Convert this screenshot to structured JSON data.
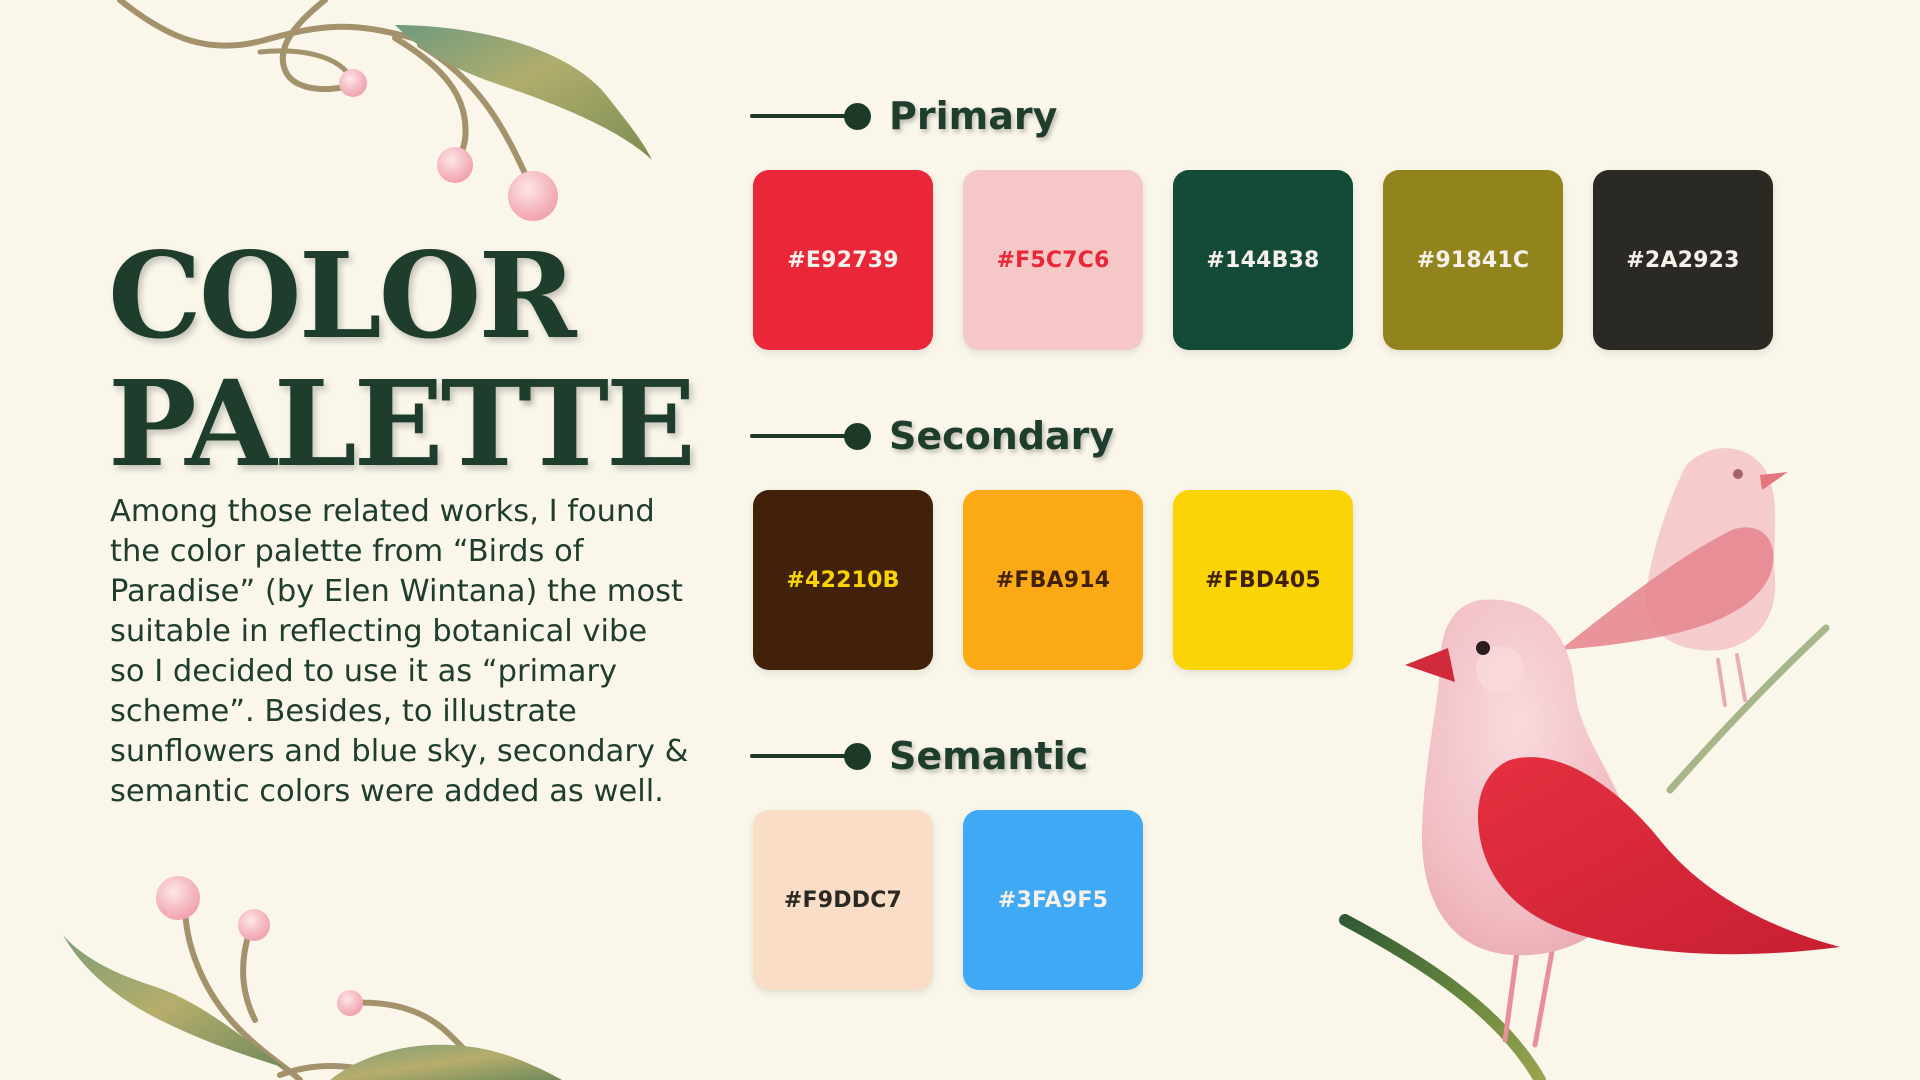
{
  "title": {
    "line1": "COLOR",
    "line2": "PALETTE"
  },
  "description": "Among those related works, I found the color palette from “Birds of Paradise” (by Elen Wintana) the most suitable in reflecting botanical vibe so I decided to use it as “primary scheme”. Besides, to illustrate sunflowers and blue sky, secondary & semantic colors were added as well.",
  "sections": {
    "primary": {
      "title": "Primary",
      "swatches": [
        {
          "label": "#E92739",
          "color": "#E92739",
          "text_color": "#f6f1ea"
        },
        {
          "label": "#F5C7C6",
          "color": "#F5C7C6",
          "text_color": "#E92739"
        },
        {
          "label": "#144B38",
          "color": "#144B38",
          "text_color": "#f6f1ea"
        },
        {
          "label": "#91841C",
          "color": "#91841C",
          "text_color": "#f6f1ea"
        },
        {
          "label": "#2A2923",
          "color": "#2A2923",
          "text_color": "#f6f1ea"
        }
      ]
    },
    "secondary": {
      "title": "Secondary",
      "swatches": [
        {
          "label": "#42210B",
          "color": "#42210B",
          "text_color": "#FBD405"
        },
        {
          "label": "#FBA914",
          "color": "#FBA914",
          "text_color": "#42210B"
        },
        {
          "label": "#FBD405",
          "color": "#FBD405",
          "text_color": "#42210B"
        }
      ]
    },
    "semantic": {
      "title": "Semantic",
      "swatches": [
        {
          "label": "#F9DDC7",
          "color": "#F9DDC7",
          "text_color": "#2A2923"
        },
        {
          "label": "#3FA9F5",
          "color": "#3FA9F5",
          "text_color": "#f6f1ea"
        }
      ]
    }
  },
  "colors": {
    "background": "#faf7ea",
    "text_dark_green": "#1f3d2c",
    "branch": "#a3926c",
    "leaf": "#a9ad70",
    "berry": "#f4b8bf",
    "bird_pink": "#f3c2c6",
    "bird_red": "#d92a3c"
  },
  "decorations": {
    "top_branch": "branch-with-leaf-and-berries",
    "bottom_branch": "branch-with-leaf-and-berries",
    "front_bird": "pink-bird-with-red-wing",
    "back_bird": "faded-pink-bird"
  }
}
